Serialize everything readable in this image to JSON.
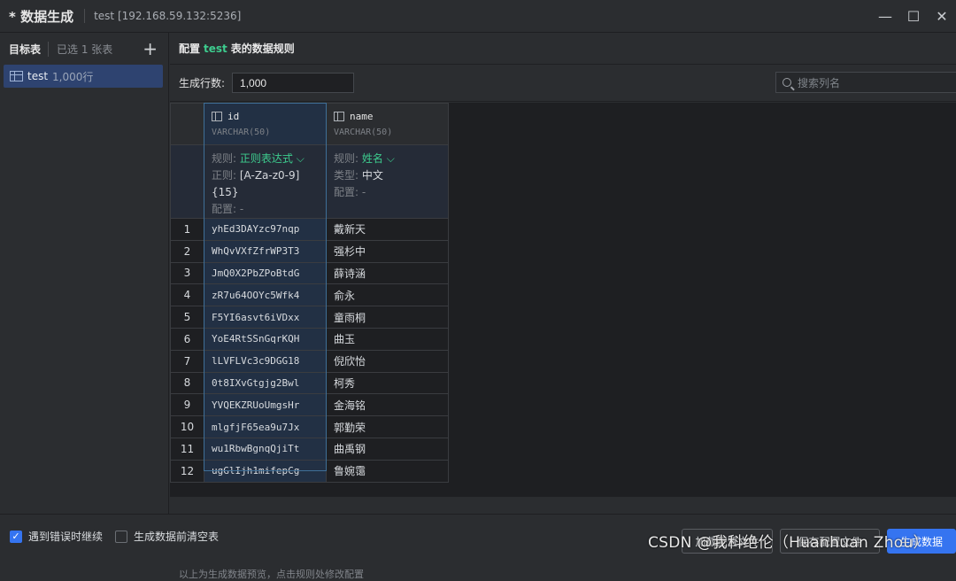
{
  "window": {
    "title": "* 数据生成",
    "connection": "test [192.168.59.132:5236]",
    "controls": [
      "—",
      "☐",
      "✕"
    ]
  },
  "sidebar": {
    "header": "目标表",
    "selected_count": "已选 1 张表",
    "add_icon": "plus-icon",
    "tables": [
      {
        "name": "test",
        "rows": "1,000行",
        "icon": "table-icon"
      }
    ]
  },
  "main": {
    "heading_prefix": "配置",
    "heading_table": "test",
    "heading_suffix": "表的数据规则",
    "row_count_label": "生成行数:",
    "row_count_value": "1,000",
    "search_placeholder": "搜索列名",
    "columns": [
      {
        "name": "id",
        "type": "VARCHAR(50)",
        "rule_key": "规则:",
        "rule_value": "正则表达式",
        "detail_key": "正则:",
        "detail_value": "[A-Za-z0-9]{15}",
        "config_key": "配置:",
        "config_value": "-"
      },
      {
        "name": "name",
        "type": "VARCHAR(50)",
        "rule_key": "规则:",
        "rule_value": "姓名",
        "detail_key": "类型:",
        "detail_value": "中文",
        "config_key": "配置:",
        "config_value": "-"
      }
    ],
    "rows": [
      {
        "n": "1",
        "id": "yhEd3DAYzc97nqp",
        "name": "戴新天"
      },
      {
        "n": "2",
        "id": "WhQvVXfZfrWP3T3",
        "name": "强杉中"
      },
      {
        "n": "3",
        "id": "JmQ0X2PbZPoBtdG",
        "name": "薛诗涵"
      },
      {
        "n": "4",
        "id": "zR7u64OOYc5Wfk4",
        "name": "俞永"
      },
      {
        "n": "5",
        "id": "F5YI6asvt6iVDxx",
        "name": "童雨桐"
      },
      {
        "n": "6",
        "id": "YoE4RtSSnGqrKQH",
        "name": "曲玉"
      },
      {
        "n": "7",
        "id": "lLVFLVc3c9DGG18",
        "name": "倪欣怡"
      },
      {
        "n": "8",
        "id": "0t8IXvGtgjg2Bwl",
        "name": "柯秀"
      },
      {
        "n": "9",
        "id": "YVQEKZRUoUmgsHr",
        "name": "金海铭"
      },
      {
        "n": "10",
        "id": "mlgfjF65ea9u7Jx",
        "name": "郭勤荣"
      },
      {
        "n": "11",
        "id": "wu1RbwBgnqQjiTt",
        "name": "曲禹钢"
      },
      {
        "n": "12",
        "id": "ugGlIjh1mifepCg",
        "name": "鲁婉霭"
      }
    ],
    "footnote": "以上为生成数据预览，点击规则处修改配置"
  },
  "bottom": {
    "continue_on_error": {
      "label": "遇到错误时继续",
      "checked": true
    },
    "clear_before": {
      "label": "生成数据前清空表",
      "checked": false
    },
    "load_config": "加载配置文件",
    "save_config": "保存配置文件",
    "generate": "生成数据"
  },
  "watermark": "CSDN @我科绝伦（Huanhuan Zhou）",
  "colors": {
    "accent": "#3574f0",
    "rule_green": "#3dcc8e",
    "selected_item": "#2e4370"
  }
}
